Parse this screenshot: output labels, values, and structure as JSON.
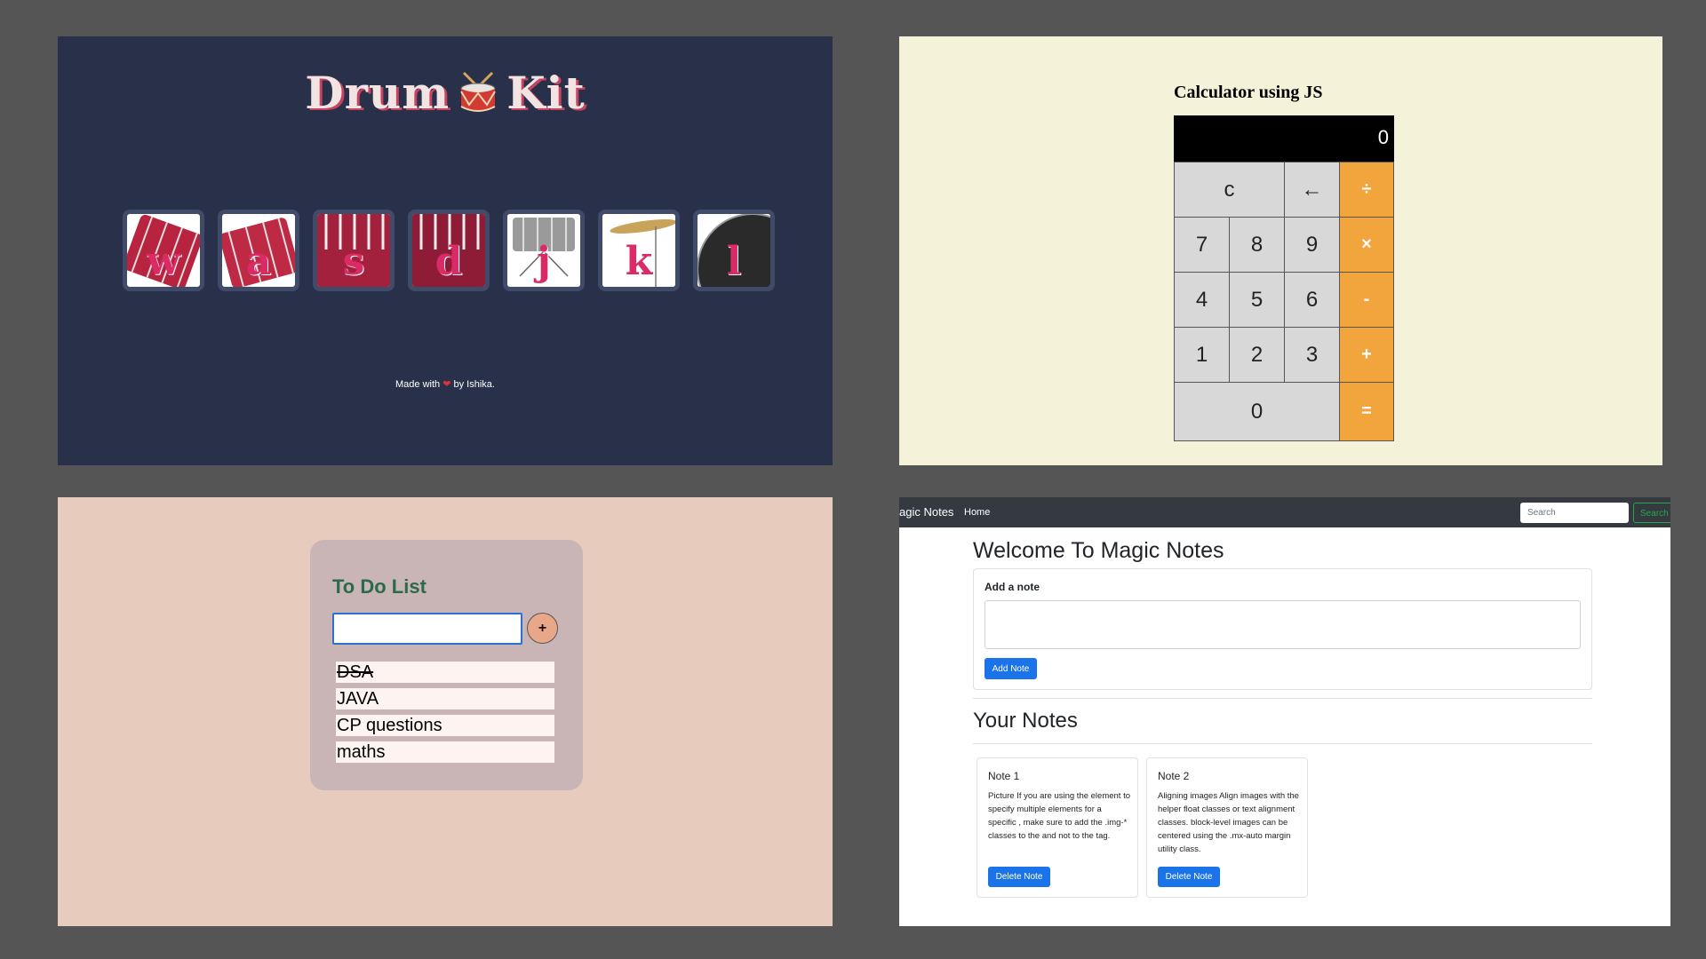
{
  "drum_kit": {
    "title_left": "Drum",
    "title_right": "Kit",
    "keys": [
      "w",
      "a",
      "s",
      "d",
      "j",
      "k",
      "l"
    ],
    "footer_prefix": "Made with",
    "footer_heart": "❤",
    "footer_suffix": "by Ishika."
  },
  "calculator": {
    "title": "Calculator using JS",
    "display": "0",
    "buttons": {
      "clear": "c",
      "back": "←",
      "divide": "÷",
      "seven": "7",
      "eight": "8",
      "nine": "9",
      "multiply": "×",
      "four": "4",
      "five": "5",
      "six": "6",
      "minus": "-",
      "one": "1",
      "two": "2",
      "three": "3",
      "plus": "+",
      "zero": "0",
      "equals": "="
    },
    "colors": {
      "operator": "#f2a53c",
      "display_bg": "#000000"
    }
  },
  "todo": {
    "title": "To Do List",
    "input_value": "",
    "add_label": "+",
    "items": [
      {
        "text": "DSA",
        "done": true
      },
      {
        "text": "JAVA",
        "done": false
      },
      {
        "text": "CP questions",
        "done": false
      },
      {
        "text": "maths",
        "done": false
      }
    ]
  },
  "notes": {
    "brand": "agic Notes",
    "nav_home": "Home",
    "search_placeholder": "Search",
    "search_button": "Search",
    "welcome": "Welcome To Magic Notes",
    "add_label": "Add a note",
    "textarea_value": "",
    "add_button": "Add Note",
    "your_notes": "Your Notes",
    "cards": [
      {
        "title": "Note 1",
        "text": "Picture If you are using the element to specify multiple elements for a specific , make sure to add the .img-* classes to the  and not to the tag.",
        "delete": "Delete Note"
      },
      {
        "title": "Note 2",
        "text": "Aligning images Align images with the helper float classes or text alignment classes. block-level images can be centered using the .mx-auto margin utility class.",
        "delete": "Delete Note"
      }
    ]
  }
}
